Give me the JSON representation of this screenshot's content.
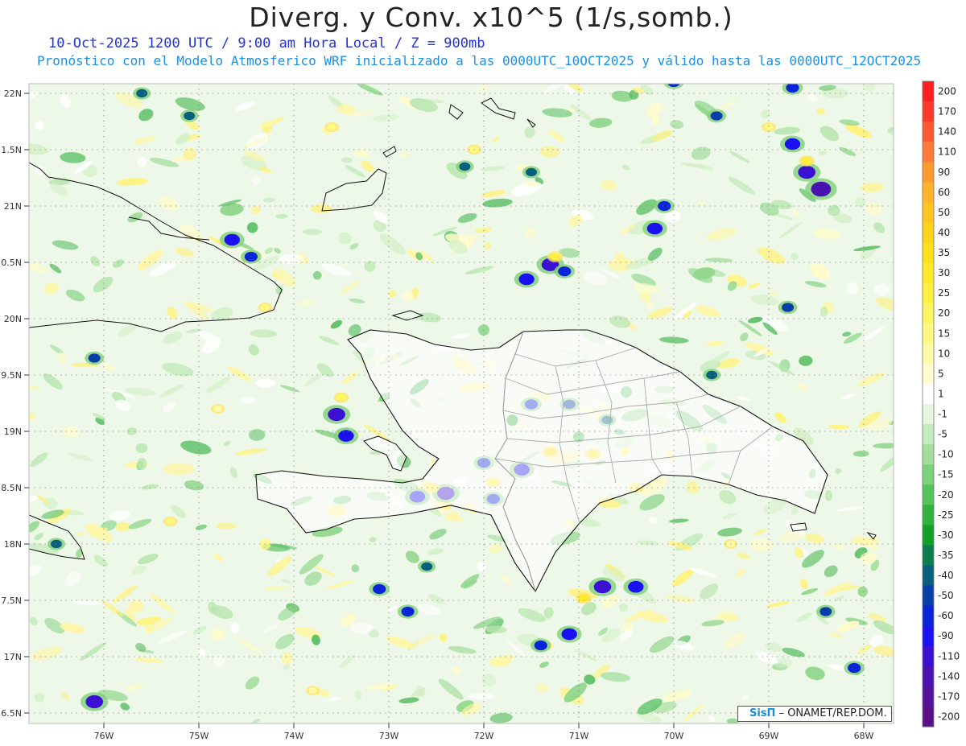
{
  "header": {
    "title": "Diverg. y Conv. x10^5 (1/s,somb.)",
    "subtitle_1": "10-Oct-2025  1200 UTC / 9:00 am Hora Local / Z = 900mb",
    "subtitle_2": "Pronóstico con el Modelo Atmosferico WRF inicializado a las 0000UTC_10OCT2025 y válido hasta las  0000UTC_12OCT2025"
  },
  "axes": {
    "lat_labels": [
      {
        "lat": 22.0,
        "label": "22N"
      },
      {
        "lat": 21.5,
        "label": "1.5N"
      },
      {
        "lat": 21.0,
        "label": "21N"
      },
      {
        "lat": 20.5,
        "label": "0.5N"
      },
      {
        "lat": 20.0,
        "label": "20N"
      },
      {
        "lat": 19.5,
        "label": "9.5N"
      },
      {
        "lat": 19.0,
        "label": "19N"
      },
      {
        "lat": 18.5,
        "label": "8.5N"
      },
      {
        "lat": 18.0,
        "label": "18N"
      },
      {
        "lat": 17.5,
        "label": "7.5N"
      },
      {
        "lat": 17.0,
        "label": "17N"
      },
      {
        "lat": 16.5,
        "label": "6.5N"
      }
    ],
    "lon_labels": [
      {
        "lon": -76,
        "label": "76W"
      },
      {
        "lon": -75,
        "label": "75W"
      },
      {
        "lon": -74,
        "label": "74W"
      },
      {
        "lon": -73,
        "label": "73W"
      },
      {
        "lon": -72,
        "label": "72W"
      },
      {
        "lon": -71,
        "label": "71W"
      },
      {
        "lon": -70,
        "label": "70W"
      },
      {
        "lon": -69,
        "label": "69W"
      },
      {
        "lon": -68,
        "label": "68W"
      }
    ],
    "lat_range": [
      16.4,
      22.1
    ],
    "lon_range": [
      -76.65,
      -67.65
    ],
    "grid": "dotted"
  },
  "colorbar": {
    "labels": [
      "200",
      "170",
      "140",
      "110",
      "90",
      "60",
      "50",
      "40",
      "35",
      "30",
      "25",
      "20",
      "15",
      "10",
      "5",
      "1",
      "-1",
      "-5",
      "-10",
      "-15",
      "-20",
      "-25",
      "-30",
      "-35",
      "-40",
      "-50",
      "-60",
      "-90",
      "-110",
      "-140",
      "-170",
      "-200"
    ],
    "colors": [
      "#ff2020",
      "#ff3a2a",
      "#ff5a32",
      "#ff7a36",
      "#ff9a30",
      "#ffb42a",
      "#ffc520",
      "#ffd31a",
      "#ffe018",
      "#ffe92a",
      "#fff040",
      "#fff560",
      "#fff882",
      "#fffaa8",
      "#fffcd0",
      "#ffffff",
      "#e6f6e0",
      "#c4ecc0",
      "#a0e09c",
      "#7ad27a",
      "#54c45a",
      "#30b23e",
      "#12a028",
      "#0e7e4e",
      "#0a5e7e",
      "#083ea8",
      "#0a24d8",
      "#1a10f0",
      "#3a10d2",
      "#4a12b0",
      "#54129a",
      "#5a1086"
    ]
  },
  "map": {
    "field": [
      {
        "lon": -71.3,
        "lat": 20.48,
        "value": -110
      },
      {
        "lon": -71.15,
        "lat": 20.42,
        "value": -60
      },
      {
        "lon": -71.55,
        "lat": 20.35,
        "value": -90
      },
      {
        "lon": -72.0,
        "lat": 18.72,
        "value": -60
      },
      {
        "lon": -71.6,
        "lat": 18.66,
        "value": -90
      },
      {
        "lon": -72.4,
        "lat": 18.45,
        "value": -110
      },
      {
        "lon": -72.7,
        "lat": 18.42,
        "value": -90
      },
      {
        "lon": -71.9,
        "lat": 18.4,
        "value": -60
      },
      {
        "lon": -73.55,
        "lat": 19.15,
        "value": -110
      },
      {
        "lon": -73.45,
        "lat": 18.96,
        "value": -90
      },
      {
        "lon": -71.5,
        "lat": 19.24,
        "value": -60
      },
      {
        "lon": -71.1,
        "lat": 19.24,
        "value": -50
      },
      {
        "lon": -70.7,
        "lat": 19.1,
        "value": -40
      },
      {
        "lon": -70.75,
        "lat": 17.62,
        "value": -110
      },
      {
        "lon": -70.4,
        "lat": 17.62,
        "value": -90
      },
      {
        "lon": -71.1,
        "lat": 17.2,
        "value": -90
      },
      {
        "lon": -71.4,
        "lat": 17.1,
        "value": -60
      },
      {
        "lon": -68.6,
        "lat": 21.3,
        "value": -110
      },
      {
        "lon": -68.45,
        "lat": 21.15,
        "value": -140
      },
      {
        "lon": -68.75,
        "lat": 21.55,
        "value": -90
      },
      {
        "lon": -68.75,
        "lat": 22.05,
        "value": -60
      },
      {
        "lon": -69.55,
        "lat": 21.8,
        "value": -50
      },
      {
        "lon": -70.1,
        "lat": 21.0,
        "value": -60
      },
      {
        "lon": -70.2,
        "lat": 20.8,
        "value": -90
      },
      {
        "lon": -70.0,
        "lat": 22.1,
        "value": -60
      },
      {
        "lon": -74.65,
        "lat": 20.7,
        "value": -90
      },
      {
        "lon": -74.45,
        "lat": 20.55,
        "value": -60
      },
      {
        "lon": -75.1,
        "lat": 21.8,
        "value": -40
      },
      {
        "lon": -75.6,
        "lat": 22.0,
        "value": -40
      },
      {
        "lon": -76.1,
        "lat": 19.65,
        "value": -50
      },
      {
        "lon": -76.5,
        "lat": 18.0,
        "value": -40
      },
      {
        "lon": -76.1,
        "lat": 16.6,
        "value": -110
      },
      {
        "lon": -73.1,
        "lat": 17.6,
        "value": -60
      },
      {
        "lon": -72.8,
        "lat": 17.4,
        "value": -60
      },
      {
        "lon": -72.6,
        "lat": 17.8,
        "value": -40
      },
      {
        "lon": -69.6,
        "lat": 19.5,
        "value": -40
      },
      {
        "lon": -68.8,
        "lat": 20.1,
        "value": -50
      },
      {
        "lon": -68.1,
        "lat": 16.9,
        "value": -60
      },
      {
        "lon": -68.4,
        "lat": 17.4,
        "value": -50
      },
      {
        "lon": -72.2,
        "lat": 21.35,
        "value": -40
      },
      {
        "lon": -71.5,
        "lat": 21.3,
        "value": -40
      },
      {
        "lon": -71.3,
        "lat": 18.82,
        "value": 35
      },
      {
        "lon": -70.85,
        "lat": 18.8,
        "value": 30
      },
      {
        "lon": -70.95,
        "lat": 17.52,
        "value": 30
      },
      {
        "lon": -71.9,
        "lat": 18.55,
        "value": 25
      },
      {
        "lon": -72.55,
        "lat": 18.5,
        "value": 25
      },
      {
        "lon": -70.4,
        "lat": 18.5,
        "value": 20
      },
      {
        "lon": -73.5,
        "lat": 19.3,
        "value": 20
      },
      {
        "lon": -68.6,
        "lat": 21.4,
        "value": 25
      },
      {
        "lon": -71.25,
        "lat": 20.55,
        "value": 25
      },
      {
        "lon": -74.3,
        "lat": 20.1,
        "value": 15
      },
      {
        "lon": -69.0,
        "lat": 21.7,
        "value": 15
      },
      {
        "lon": -75.3,
        "lat": 18.2,
        "value": 15
      },
      {
        "lon": -72.1,
        "lat": 21.5,
        "value": 15
      },
      {
        "lon": -73.6,
        "lat": 21.7,
        "value": 15
      },
      {
        "lon": -74.8,
        "lat": 19.2,
        "value": 10
      },
      {
        "lon": -69.4,
        "lat": 18.0,
        "value": 10
      },
      {
        "lon": -73.8,
        "lat": 16.7,
        "value": 10
      }
    ],
    "label_points": [
      {
        "lon": -71.7,
        "lat": 19.1,
        "value": -30
      },
      {
        "lon": -71.0,
        "lat": 18.95,
        "value": -25
      },
      {
        "lon": -70.5,
        "lat": 19.35,
        "value": -20
      },
      {
        "lon": -72.0,
        "lat": 19.9,
        "value": -15
      },
      {
        "lon": -69.6,
        "lat": 18.85,
        "value": -10
      },
      {
        "lon": -73.2,
        "lat": 19.7,
        "value": -5
      },
      {
        "lon": -72.8,
        "lat": 20.2,
        "value": 5
      },
      {
        "lon": -70.3,
        "lat": 20.2,
        "value": 10
      },
      {
        "lon": -74.3,
        "lat": 18.0,
        "value": 15
      }
    ],
    "grid_density": "coarse"
  },
  "credit": {
    "brand": "SisΠ",
    "text": " – ONAMET/REP.DOM."
  }
}
